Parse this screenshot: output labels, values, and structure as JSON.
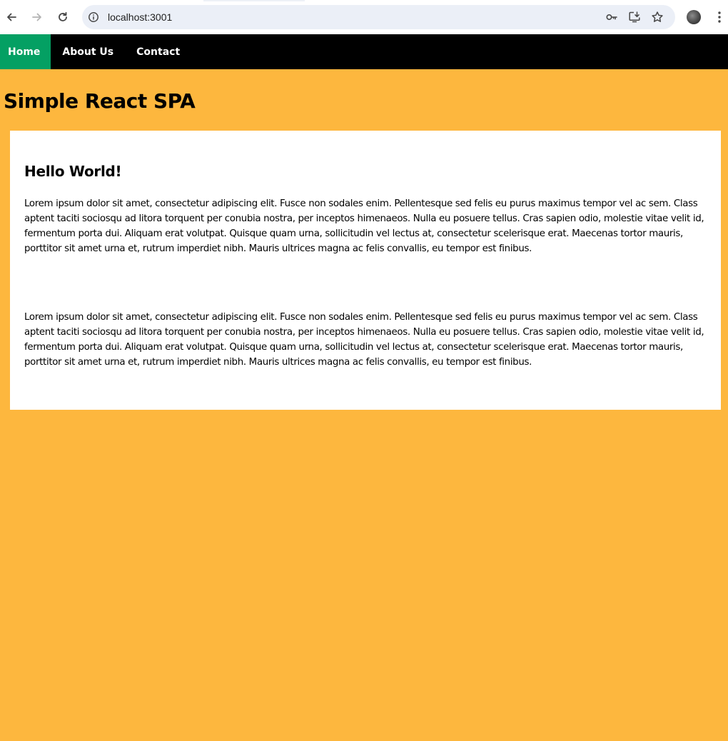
{
  "browser": {
    "url": "localhost:3001",
    "icons": [
      "back-arrow-icon",
      "forward-arrow-icon",
      "reload-icon",
      "site-info-icon",
      "password-key-icon",
      "install-app-icon",
      "bookmark-star-icon",
      "profile-avatar",
      "kebab-menu-icon"
    ]
  },
  "nav": {
    "home": "Home",
    "about": "About Us",
    "contact": "Contact",
    "active_color": "#04a063",
    "bar_color": "#000000"
  },
  "page": {
    "title": "Simple React SPA",
    "background_color": "#fdb73e"
  },
  "card": {
    "heading": "Hello World!",
    "paragraphs": [
      "Lorem ipsum dolor sit amet, consectetur adipiscing elit. Fusce non sodales enim. Pellentesque sed felis eu purus maximus tempor vel ac sem. Class aptent taciti sociosqu ad litora torquent per conubia nostra, per inceptos himenaeos. Nulla eu posuere tellus. Cras sapien odio, molestie vitae velit id, fermentum porta dui. Aliquam erat volutpat. Quisque quam urna, sollicitudin vel lectus at, consectetur scelerisque erat. Maecenas tortor mauris, porttitor sit amet urna et, rutrum imperdiet nibh. Mauris ultrices magna ac felis convallis, eu tempor est finibus.",
      "Lorem ipsum dolor sit amet, consectetur adipiscing elit. Fusce non sodales enim. Pellentesque sed felis eu purus maximus tempor vel ac sem. Class aptent taciti sociosqu ad litora torquent per conubia nostra, per inceptos himenaeos. Nulla eu posuere tellus. Cras sapien odio, molestie vitae velit id, fermentum porta dui. Aliquam erat volutpat. Quisque quam urna, sollicitudin vel lectus at, consectetur scelerisque erat. Maecenas tortor mauris, porttitor sit amet urna et, rutrum imperdiet nibh. Mauris ultrices magna ac felis convallis, eu tempor est finibus."
    ]
  }
}
